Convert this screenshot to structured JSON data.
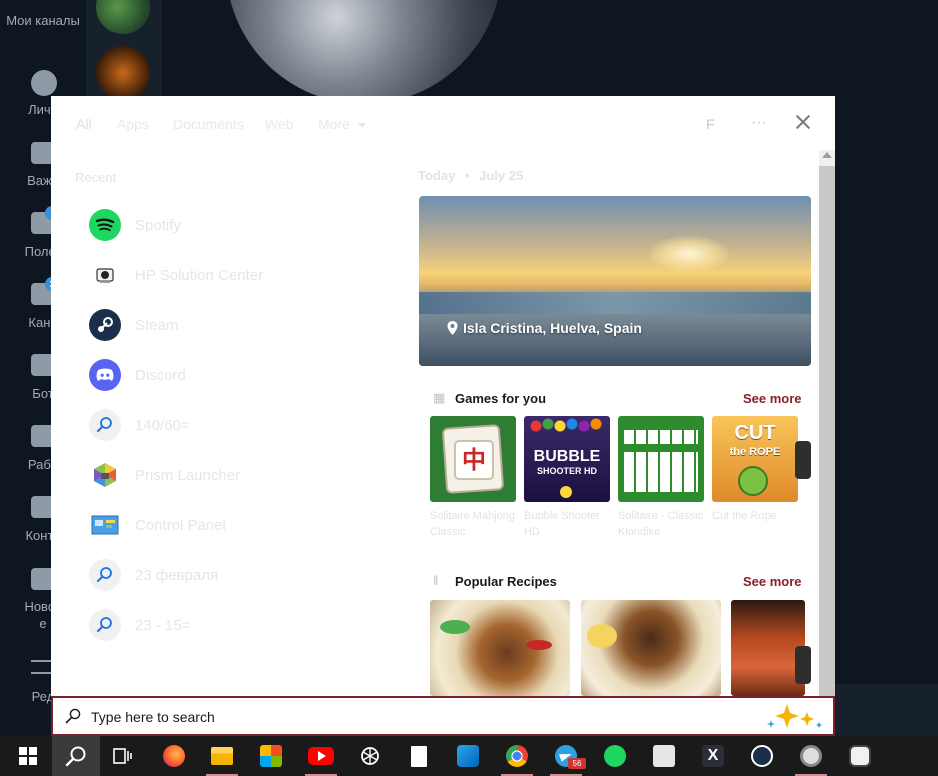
{
  "background_app": {
    "sidebar_items": [
      {
        "label": "Мои каналы",
        "line2": "каналы",
        "icon": "channels-icon"
      },
      {
        "label": "Личн",
        "icon": "person-icon"
      },
      {
        "label": "Важн",
        "icon": "folder-icon"
      },
      {
        "label": "Полез",
        "icon": "folder-icon"
      },
      {
        "label": "Кана",
        "icon": "folder-icon",
        "badge": "2"
      },
      {
        "label": "Бот",
        "icon": "folder-icon"
      },
      {
        "label": "Рабо",
        "icon": "folder-icon"
      },
      {
        "label": "Конте",
        "icon": "folder-icon"
      },
      {
        "label": "Новос",
        "line2": "е",
        "icon": "folder-icon"
      },
      {
        "label": "Ред",
        "icon": "sliders-icon"
      }
    ]
  },
  "search_panel": {
    "tabs": [
      {
        "label": "All",
        "active": true
      },
      {
        "label": "Apps"
      },
      {
        "label": "Documents"
      },
      {
        "label": "Web"
      },
      {
        "label": "More"
      }
    ],
    "account_initial": "F",
    "more_options": "···",
    "recent_heading": "Recent",
    "recent_items": [
      {
        "label": "Spotify",
        "icon": "spotify-icon"
      },
      {
        "label": "HP Solution Center",
        "icon": "hp-solution-center-icon"
      },
      {
        "label": "Steam",
        "icon": "steam-icon"
      },
      {
        "label": "Discord",
        "icon": "discord-icon"
      },
      {
        "label": "140/60=",
        "icon": "search-result-icon"
      },
      {
        "label": "Prism Launcher",
        "icon": "prism-launcher-icon"
      },
      {
        "label": "Control Panel",
        "icon": "control-panel-icon"
      },
      {
        "label": "23 февраля",
        "icon": "search-result-icon"
      },
      {
        "label": "23 - 15=",
        "icon": "search-result-icon"
      }
    ],
    "today": {
      "label": "Today",
      "separator": "•",
      "date": "July 25"
    },
    "hero": {
      "location": "Isla Cristina, Huelva, Spain"
    },
    "games_section": {
      "title": "Games for you",
      "see_more": "See more",
      "games": [
        {
          "name": "Solitaire Mahjong Classic",
          "art_text": "中"
        },
        {
          "name": "Bubble Shooter HD",
          "art_text": "BUBBLE",
          "art_sub": "SHOOTER HD"
        },
        {
          "name": "Solitaire - Classic Klondike",
          "art_text": ""
        },
        {
          "name": "Cut the Rope",
          "art_text": "CUT",
          "art_sub": "the ROPE"
        }
      ]
    },
    "recipes_section": {
      "title": "Popular Recipes",
      "see_more": "See more"
    }
  },
  "search_box": {
    "placeholder": "Type here to search"
  },
  "taskbar": {
    "items": [
      {
        "icon": "windows-start-icon"
      },
      {
        "icon": "search-icon",
        "active": true
      },
      {
        "icon": "task-view-icon"
      },
      {
        "icon": "firefox-icon"
      },
      {
        "icon": "file-explorer-icon",
        "running": true
      },
      {
        "icon": "microsoft-store-icon"
      },
      {
        "icon": "youtube-icon",
        "running": true
      },
      {
        "icon": "chatgpt-icon"
      },
      {
        "icon": "notepad-icon"
      },
      {
        "icon": "outlook-icon"
      },
      {
        "icon": "chrome-icon",
        "running": true
      },
      {
        "icon": "telegram-icon",
        "badge": "56",
        "running": true
      },
      {
        "icon": "spotify-icon"
      },
      {
        "icon": "hp-solution-center-icon"
      },
      {
        "icon": "x-app-icon"
      },
      {
        "icon": "steam-icon"
      },
      {
        "icon": "app-ring-icon",
        "running": true
      },
      {
        "icon": "lasso-app-icon"
      }
    ]
  },
  "colors": {
    "accent": "#7a1f2b",
    "see_more": "#8a1f2a",
    "taskbar": "#1a1a1a"
  }
}
